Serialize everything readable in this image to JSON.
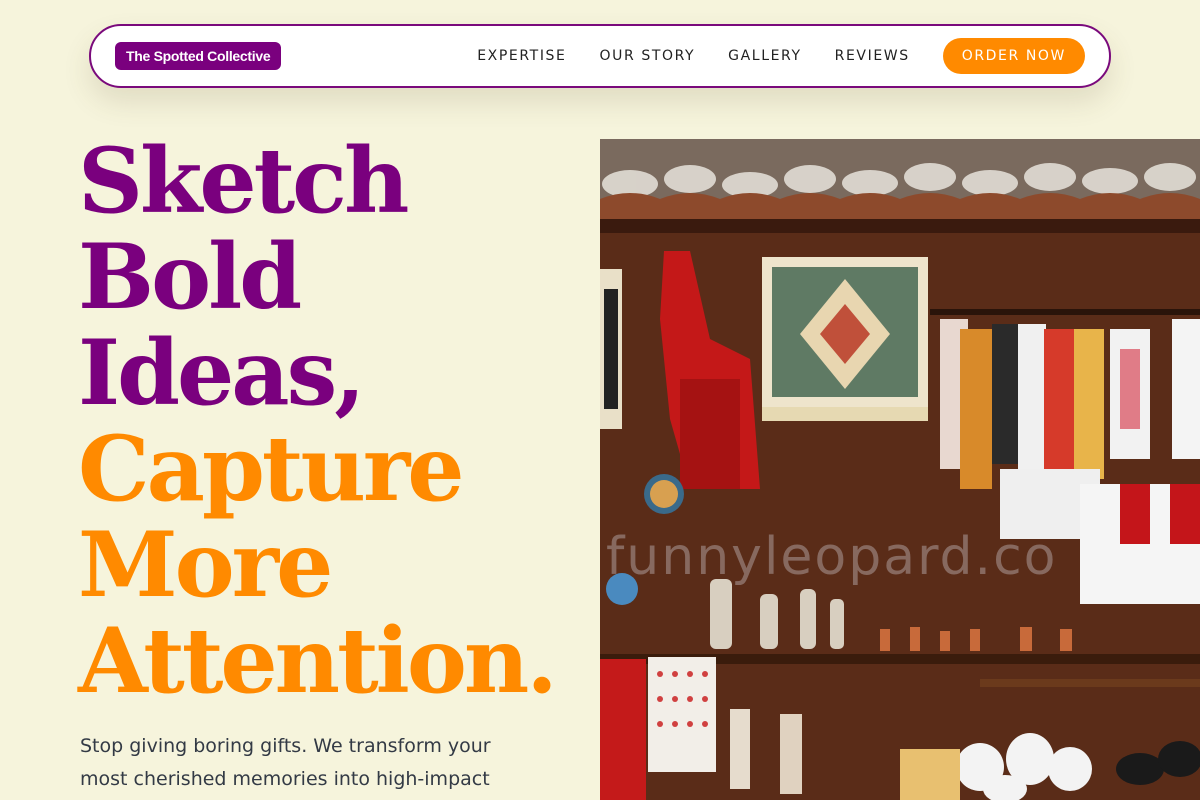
{
  "brand": {
    "name": "The Spotted Collective"
  },
  "nav": {
    "links": [
      "EXPERTISE",
      "OUR STORY",
      "GALLERY",
      "REVIEWS"
    ],
    "cta": "ORDER NOW"
  },
  "hero": {
    "title_purple": [
      "Sketch",
      "Bold",
      "Ideas,"
    ],
    "title_orange": [
      "Capture",
      "More",
      "Attention."
    ],
    "subtitle": "Stop giving boring gifts. We transform your most cherished memories into high-impact",
    "image_watermark": "funnyleopard.co"
  },
  "colors": {
    "background": "#f6f4dc",
    "purple": "#7a007e",
    "orange": "#ff8a00"
  }
}
